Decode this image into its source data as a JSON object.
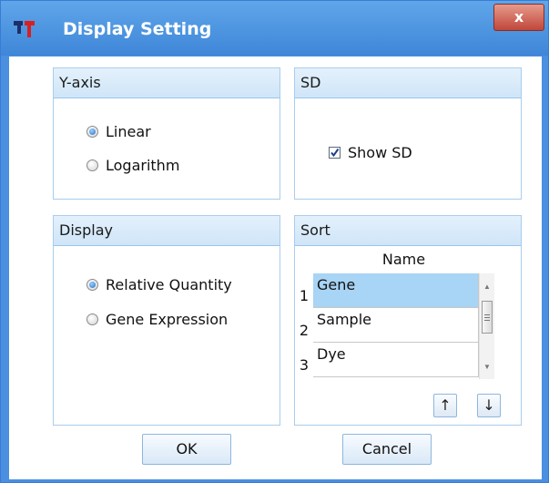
{
  "window": {
    "title": "Display Setting",
    "close_label": "x"
  },
  "yaxis": {
    "header": "Y-axis",
    "options": [
      "Linear",
      "Logarithm"
    ],
    "selected": "Linear"
  },
  "sd": {
    "header": "SD",
    "show_sd_label": "Show SD",
    "show_sd_checked": true
  },
  "display": {
    "header": "Display",
    "options": [
      "Relative Quantity",
      "Gene Expression"
    ],
    "selected": "Relative Quantity"
  },
  "sort": {
    "header": "Sort",
    "column_header": "Name",
    "rows": [
      {
        "num": "1",
        "name": "Gene",
        "selected": true
      },
      {
        "num": "2",
        "name": "Sample",
        "selected": false
      },
      {
        "num": "3",
        "name": "Dye",
        "selected": false
      }
    ],
    "up_label": "↑",
    "down_label": "↓"
  },
  "buttons": {
    "ok": "OK",
    "cancel": "Cancel"
  },
  "colors": {
    "titlebar": "#4a8fe0",
    "group_header": "#d6e9f9",
    "selection": "#a8d4f5",
    "close": "#c0473a"
  }
}
